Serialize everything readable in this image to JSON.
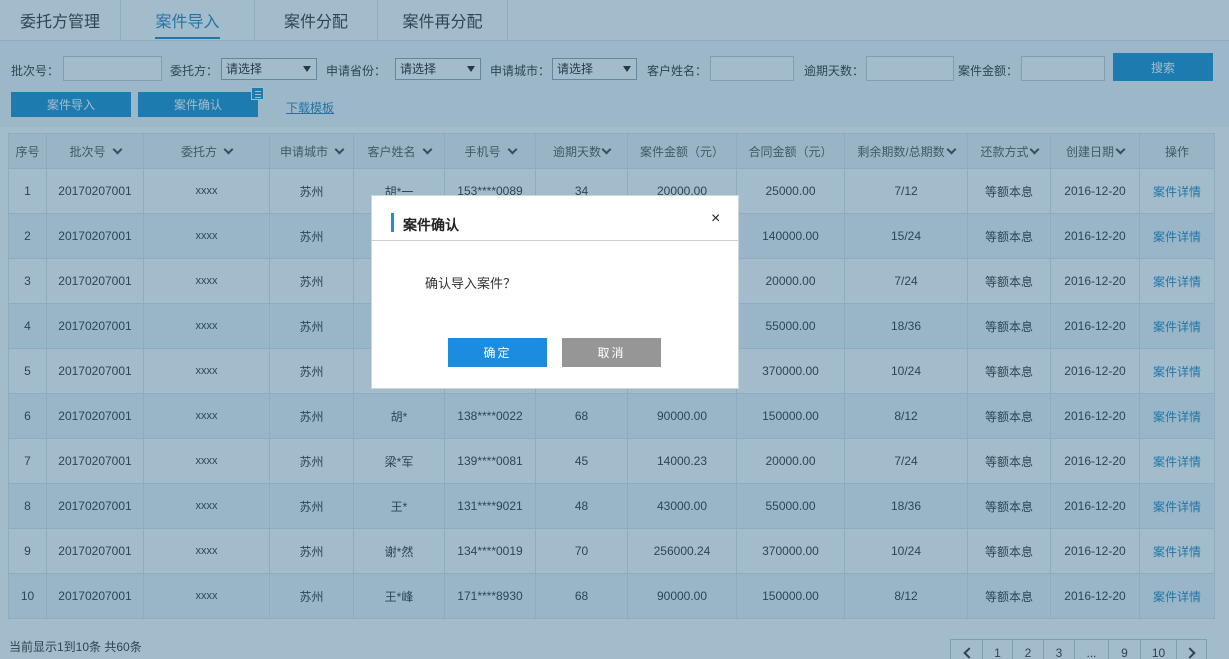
{
  "tabs": [
    {
      "label": "委托方管理"
    },
    {
      "label": "案件导入"
    },
    {
      "label": "案件分配"
    },
    {
      "label": "案件再分配"
    }
  ],
  "filters": {
    "batch_label": "批次号：",
    "client_label": "委托方：",
    "client_value": "请选择",
    "province_label": "申请省份：",
    "province_value": "请选择",
    "city_label": "申请城市：",
    "city_value": "请选择",
    "customer_label": "客户姓名：",
    "overdue_label": "逾期天数：",
    "amount_label": "案件金额：",
    "search_label": "搜索"
  },
  "actions": {
    "import_label": "案件导入",
    "confirm_label": "案件确认",
    "download_label": "下载模板"
  },
  "table": {
    "headers": [
      "序号",
      "批次号",
      "委托方",
      "申请城市",
      "客户姓名",
      "手机号",
      "逾期天数",
      "案件金额（元）",
      "合同金额（元）",
      "剩余期数/总期数",
      "还款方式",
      "创建日期",
      "操作"
    ],
    "rows": [
      [
        "1",
        "20170207001",
        "xxxx",
        "苏州",
        "胡*一",
        "153****0089",
        "34",
        "20000.00",
        "25000.00",
        "7/12",
        "等额本息",
        "2016-12-20",
        "案件详情"
      ],
      [
        "2",
        "20170207001",
        "xxxx",
        "苏州",
        "",
        "",
        "",
        "",
        "140000.00",
        "15/24",
        "等额本息",
        "2016-12-20",
        "案件详情"
      ],
      [
        "3",
        "20170207001",
        "xxxx",
        "苏州",
        "",
        "",
        "",
        "",
        "20000.00",
        "7/24",
        "等额本息",
        "2016-12-20",
        "案件详情"
      ],
      [
        "4",
        "20170207001",
        "xxxx",
        "苏州",
        "",
        "",
        "",
        "",
        "55000.00",
        "18/36",
        "等额本息",
        "2016-12-20",
        "案件详情"
      ],
      [
        "5",
        "20170207001",
        "xxxx",
        "苏州",
        "",
        "",
        "",
        "",
        "370000.00",
        "10/24",
        "等额本息",
        "2016-12-20",
        "案件详情"
      ],
      [
        "6",
        "20170207001",
        "xxxx",
        "苏州",
        "胡*",
        "138****0022",
        "68",
        "90000.00",
        "150000.00",
        "8/12",
        "等额本息",
        "2016-12-20",
        "案件详情"
      ],
      [
        "7",
        "20170207001",
        "xxxx",
        "苏州",
        "梁*军",
        "139****0081",
        "45",
        "14000.23",
        "20000.00",
        "7/24",
        "等额本息",
        "2016-12-20",
        "案件详情"
      ],
      [
        "8",
        "20170207001",
        "xxxx",
        "苏州",
        "王*",
        "131****9021",
        "48",
        "43000.00",
        "55000.00",
        "18/36",
        "等额本息",
        "2016-12-20",
        "案件详情"
      ],
      [
        "9",
        "20170207001",
        "xxxx",
        "苏州",
        "谢*然",
        "134****0019",
        "70",
        "256000.24",
        "370000.00",
        "10/24",
        "等额本息",
        "2016-12-20",
        "案件详情"
      ],
      [
        "10",
        "20170207001",
        "xxxx",
        "苏州",
        "王*峰",
        "171****8930",
        "68",
        "90000.00",
        "150000.00",
        "8/12",
        "等额本息",
        "2016-12-20",
        "案件详情"
      ]
    ]
  },
  "footer": {
    "info": "当前显示1到10条 共60条",
    "pages": [
      "1",
      "2",
      "3",
      "...",
      "9",
      "10"
    ]
  },
  "modal": {
    "title": "案件确认",
    "close": "×",
    "message": "确认导入案件？",
    "ok_label": "确定",
    "cancel_label": "取消"
  },
  "colors": {
    "accent": "#1d8fcf",
    "overlay": "rgba(34, 96, 130, 0.42)",
    "cancel": "#969696"
  }
}
